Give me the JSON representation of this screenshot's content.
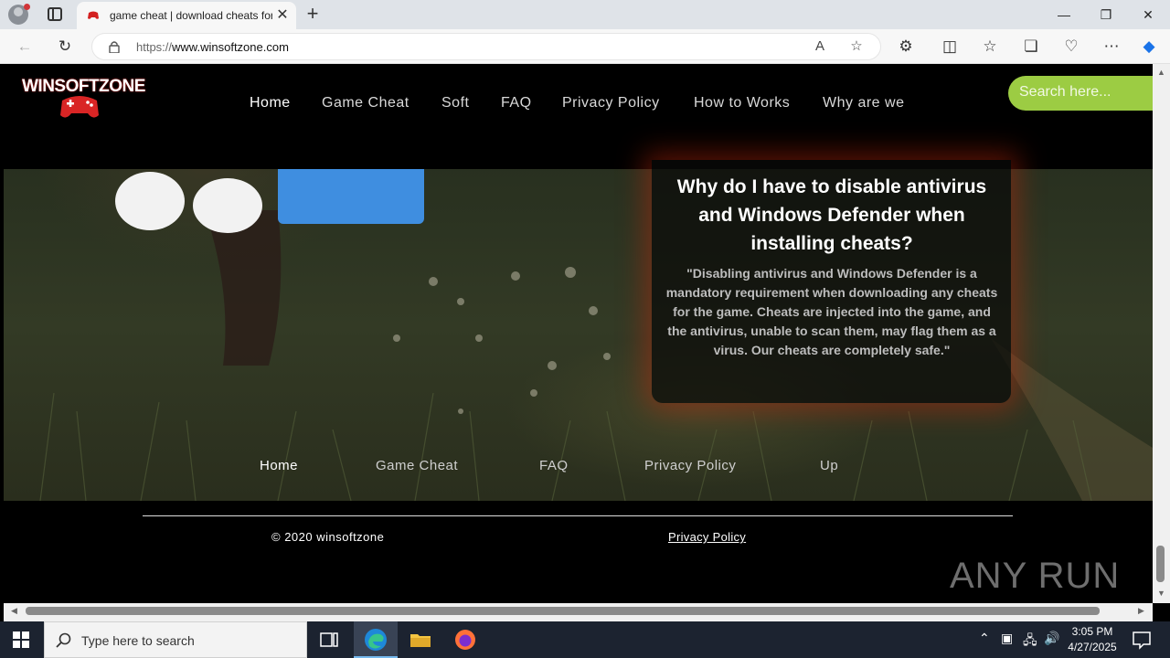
{
  "browser": {
    "tab_title": "game cheat | download cheats for",
    "url_prefix": "https://",
    "url_domain": "www.winsoftzone.com",
    "window_controls": {
      "minimize": "—",
      "restore": "❐",
      "close": "✕"
    }
  },
  "site": {
    "logo": "WINSOFTZONE",
    "nav": [
      "Home",
      "Game Cheat",
      "Soft",
      "FAQ",
      "Privacy Policy",
      "How to Works",
      "Why are we"
    ],
    "search_placeholder": "Search here...",
    "card": {
      "title": "Why do I have to disable antivirus and Windows Defender when installing cheats?",
      "text": "\"Disabling antivirus and Windows Defender is a mandatory requirement when downloading any cheats for the game. Cheats are injected into the game, and the antivirus, unable to scan them, may flag them as a virus. Our cheats are completely safe.\""
    },
    "footer_nav": [
      "Home",
      "Game Cheat",
      "FAQ",
      "Privacy Policy",
      "Up"
    ],
    "copyright": "© 2020 winsoftzone",
    "footer_privacy": "Privacy Policy",
    "accent_color": "#9ccc43"
  },
  "watermark": "ANY RUN",
  "taskbar": {
    "search_placeholder": "Type here to search",
    "time": "3:05 PM",
    "date": "4/27/2025"
  }
}
